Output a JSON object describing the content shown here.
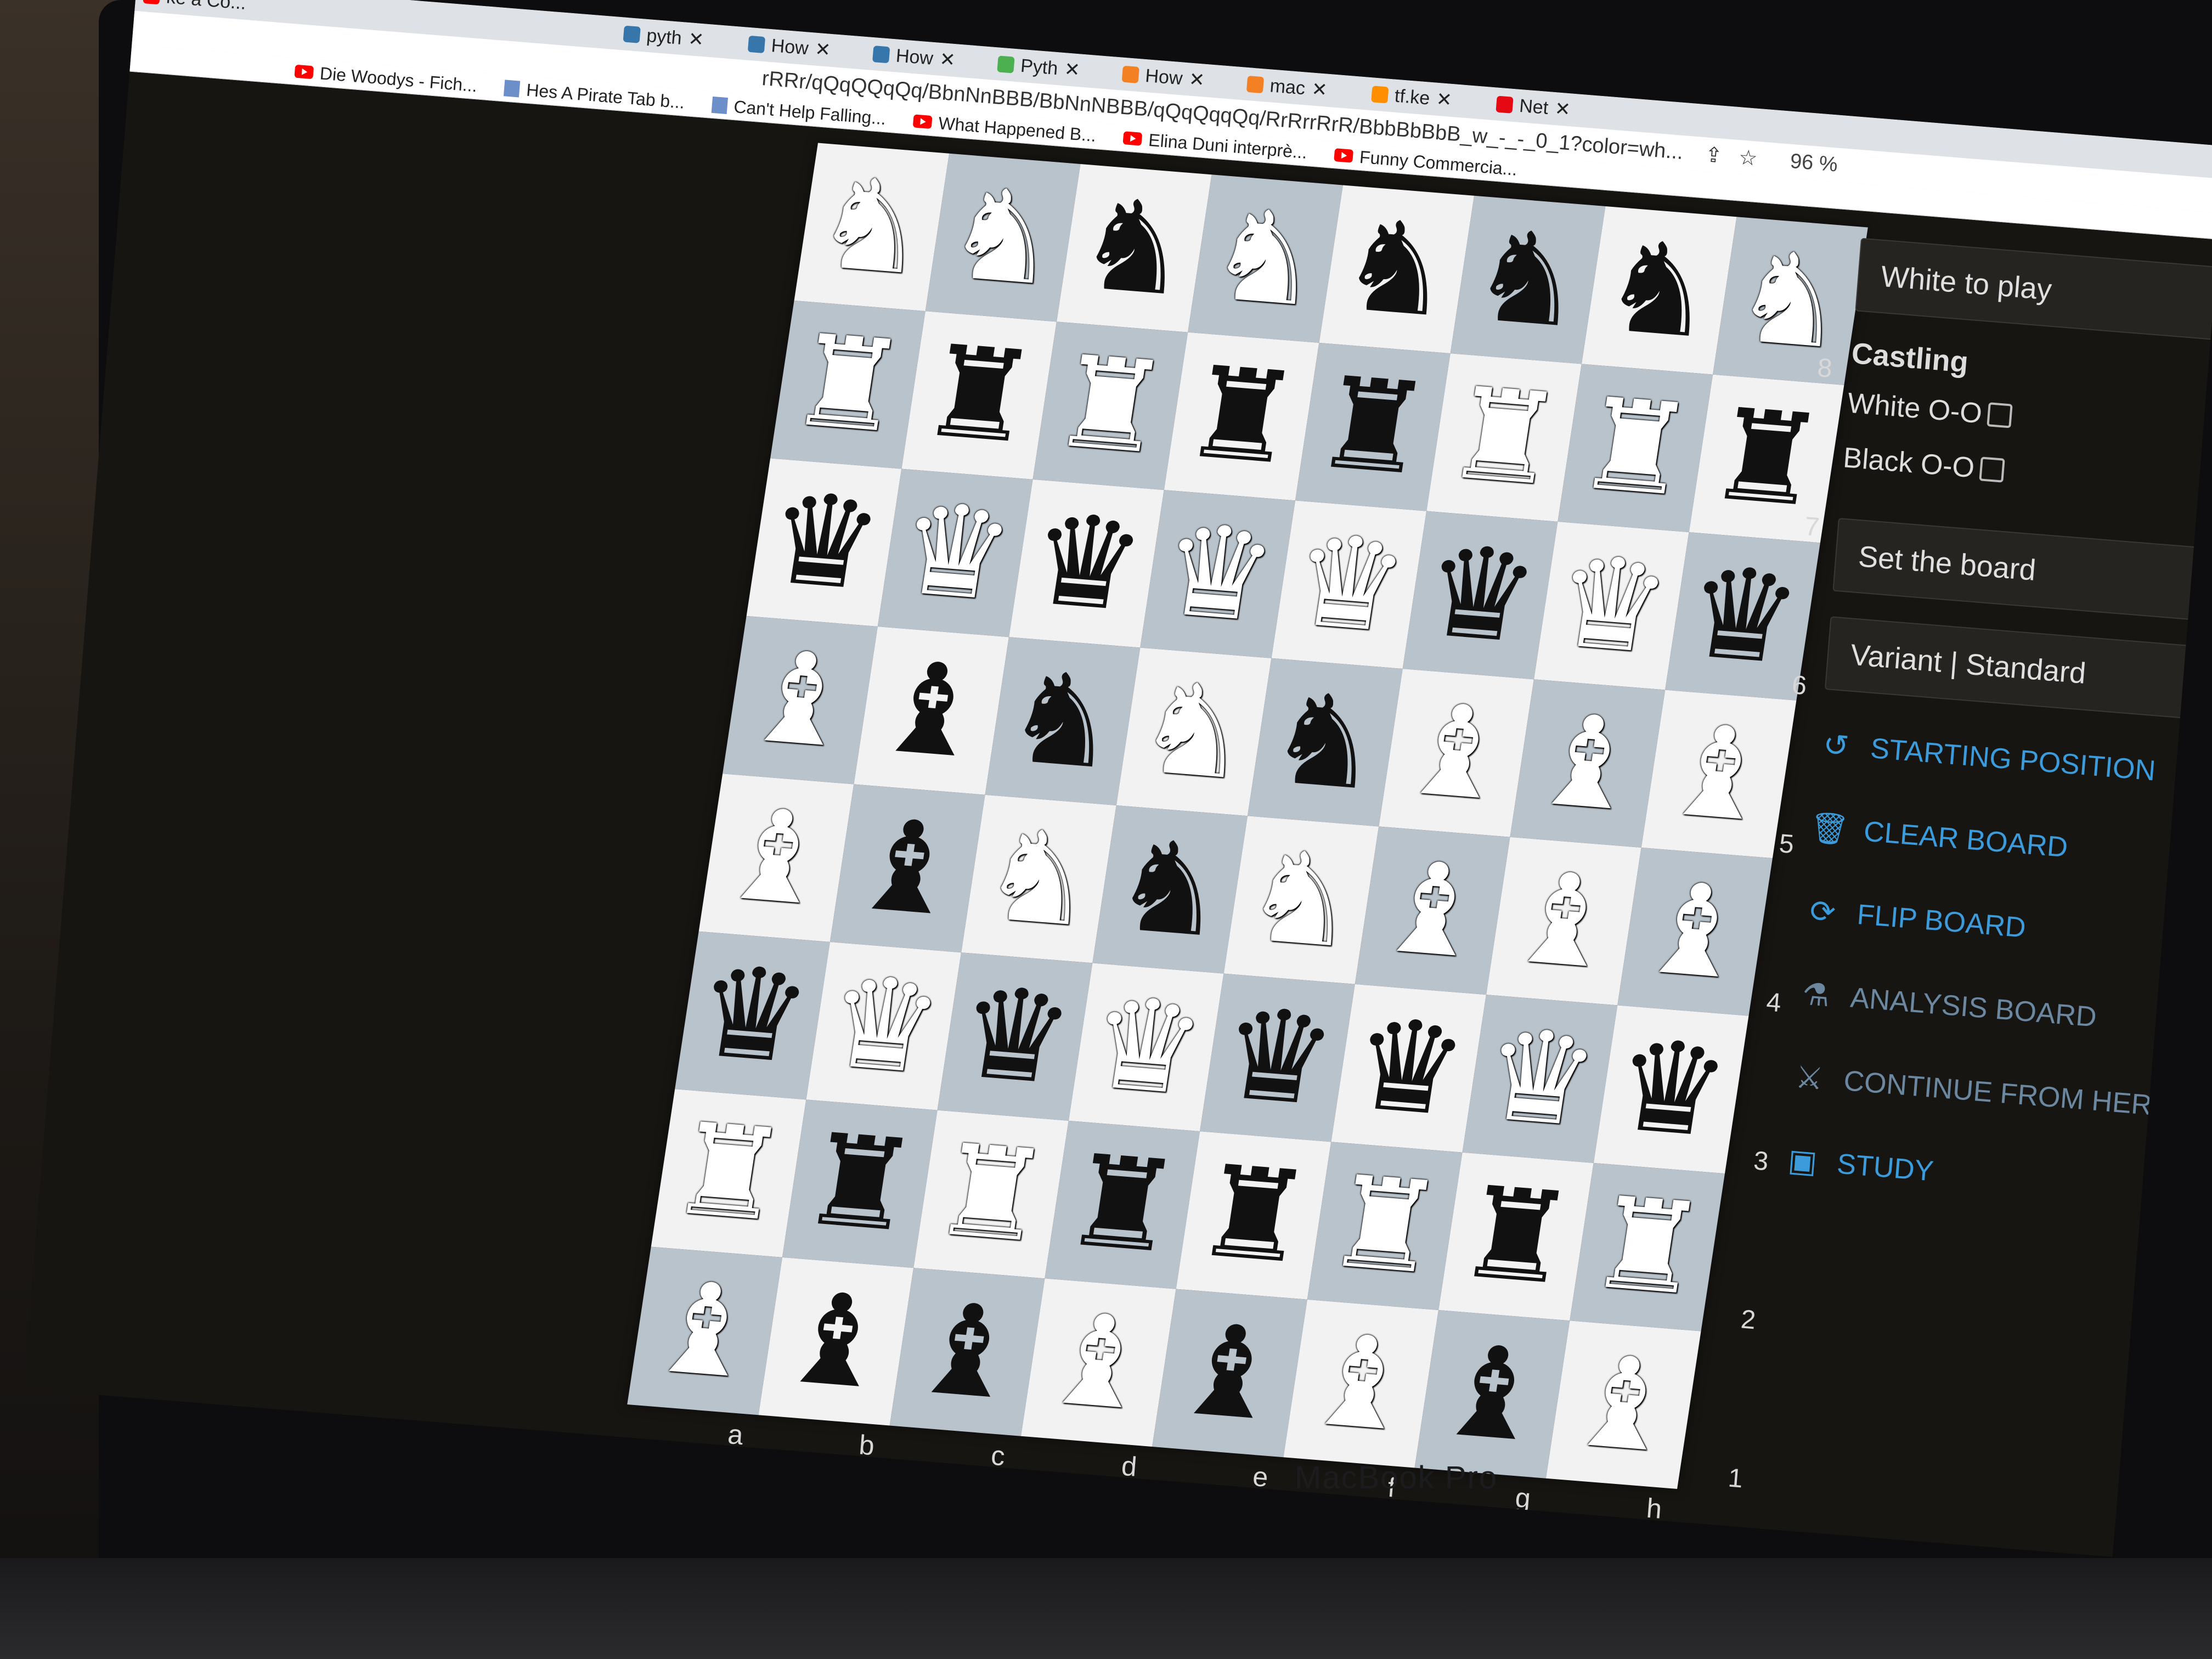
{
  "browser": {
    "tabs": [
      {
        "label": "ke a Co...",
        "icon": "youtube-icon"
      },
      {
        "label": "pyth",
        "icon": "python-icon"
      },
      {
        "label": "How",
        "icon": "python-icon"
      },
      {
        "label": "How",
        "icon": "python-icon"
      },
      {
        "label": "Pyth",
        "icon": "code-icon"
      },
      {
        "label": "How",
        "icon": "stackoverflow-icon"
      },
      {
        "label": "mac",
        "icon": "stackoverflow-icon"
      },
      {
        "label": "tf.ke",
        "icon": "tensorflow-icon"
      },
      {
        "label": "Net",
        "icon": "netflix-icon"
      }
    ],
    "url": "rRRr/qQqQQqQq/BbnNnBBB/BbNnNBBB/qQqQqqQq/RrRrrRrR/BbbBbBbB_w_-_-_0_1?color=wh...",
    "battery": "96 %",
    "bookmarks": [
      {
        "label": "Die Woodys - Fich...",
        "icon": "youtube-icon"
      },
      {
        "label": "Hes A Pirate Tab b...",
        "icon": "page-icon"
      },
      {
        "label": "Can't Help Falling...",
        "icon": "page-icon"
      },
      {
        "label": "What Happened B...",
        "icon": "youtube-icon"
      },
      {
        "label": "Elina Duni interprè...",
        "icon": "youtube-icon"
      },
      {
        "label": "Funny Commercia...",
        "icon": "youtube-icon"
      }
    ]
  },
  "board": {
    "rows": [
      "NNnNnnnN",
      "RrRrrRRr",
      "qQqQQqQq",
      "BbnNnBBB",
      "BbNnNBBB",
      "qQqQqqQq",
      "RrRrrRrR",
      "BbbBbBbB"
    ],
    "files": [
      "a",
      "b",
      "c",
      "d",
      "e",
      "f",
      "g",
      "h"
    ],
    "ranks": [
      "8",
      "7",
      "6",
      "5",
      "4",
      "3",
      "2",
      "1"
    ],
    "eval_fraction_white": 0.14
  },
  "panel": {
    "turn": "White to play",
    "castling_title": "Castling",
    "white_castle": "White O-O",
    "black_castle": "Black O-O",
    "set_board": "Set the board",
    "variant": "Variant | Standard",
    "actions": [
      {
        "label": "STARTING POSITION",
        "icon": "reset-icon"
      },
      {
        "label": "CLEAR BOARD",
        "icon": "trash-icon"
      },
      {
        "label": "FLIP BOARD",
        "icon": "flip-icon"
      },
      {
        "label": "ANALYSIS BOARD",
        "icon": "microscope-icon"
      },
      {
        "label": "CONTINUE FROM HERE",
        "icon": "swords-icon"
      },
      {
        "label": "STUDY",
        "icon": "study-icon"
      }
    ]
  },
  "laptop": {
    "brand": "MacBook Pro"
  },
  "colors": {
    "board_light": "#f2f2f2",
    "board_dark": "#b9c3cb",
    "accent_blue": "#3b9bdb",
    "eval_green": "#9acd32"
  }
}
